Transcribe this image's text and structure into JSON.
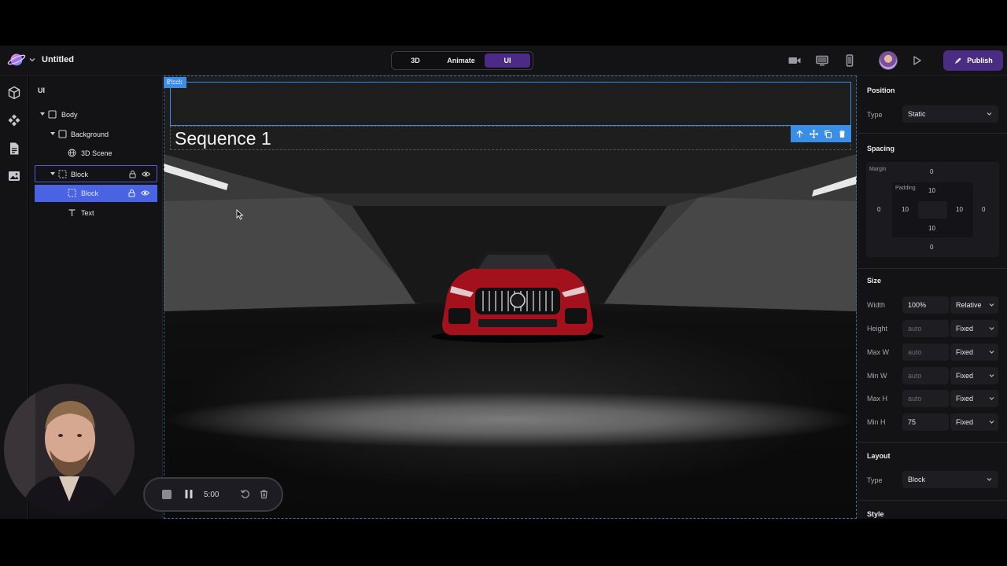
{
  "app": {
    "document_title": "Untitled",
    "publish_label": "Publish"
  },
  "mode_switch": {
    "tabs": [
      {
        "label": "3D",
        "active": false
      },
      {
        "label": "Animate",
        "active": false
      },
      {
        "label": "UI",
        "active": true
      }
    ]
  },
  "toolbar_icons": [
    "camera-icon",
    "desktop-preview-icon",
    "mobile-preview-icon",
    "play-icon"
  ],
  "rail_icons": [
    "cube-icon",
    "components-icon",
    "page-icon",
    "image-icon"
  ],
  "layers": {
    "title": "UI",
    "items": [
      {
        "label": "Body",
        "icon": "frame-icon",
        "expanded": true
      },
      {
        "label": "Background",
        "icon": "frame-icon",
        "expanded": true
      },
      {
        "label": "3D Scene",
        "icon": "globe-icon"
      },
      {
        "label": "Block",
        "icon": "dashed-frame-icon",
        "expanded": true,
        "state": "outlined"
      },
      {
        "label": "Block",
        "icon": "dashed-frame-icon",
        "state": "selected"
      },
      {
        "label": "Text",
        "icon": "text-icon"
      }
    ]
  },
  "canvas": {
    "block_tag": "Block",
    "sequence_text": "Sequence 1"
  },
  "properties": {
    "position": {
      "title": "Position",
      "type_label": "Type",
      "type_value": "Static"
    },
    "spacing": {
      "title": "Spacing",
      "margin_label": "Margin",
      "padding_label": "Padding",
      "margin": {
        "top": "0",
        "right": "0",
        "bottom": "0",
        "left": "0"
      },
      "padding": {
        "top": "10",
        "right": "10",
        "bottom": "10",
        "left": "10"
      }
    },
    "size": {
      "title": "Size",
      "rows": [
        {
          "label": "Width",
          "value": "100%",
          "placeholder": "",
          "unit": "Relative"
        },
        {
          "label": "Height",
          "value": "",
          "placeholder": "auto",
          "unit": "Fixed"
        },
        {
          "label": "Max W",
          "value": "",
          "placeholder": "auto",
          "unit": "Fixed"
        },
        {
          "label": "Min W",
          "value": "",
          "placeholder": "auto",
          "unit": "Fixed"
        },
        {
          "label": "Max H",
          "value": "",
          "placeholder": "auto",
          "unit": "Fixed"
        },
        {
          "label": "Min H",
          "value": "75",
          "placeholder": "",
          "unit": "Fixed"
        }
      ]
    },
    "layout": {
      "title": "Layout",
      "type_label": "Type",
      "type_value": "Block"
    },
    "style": {
      "title": "Style"
    }
  },
  "recorder": {
    "time": "5:00"
  },
  "colors": {
    "accent_purple": "#4b2b86",
    "selection_blue": "#4a63e3",
    "canvas_outline_blue": "#3a8ee6",
    "panel_bg": "#131316"
  }
}
